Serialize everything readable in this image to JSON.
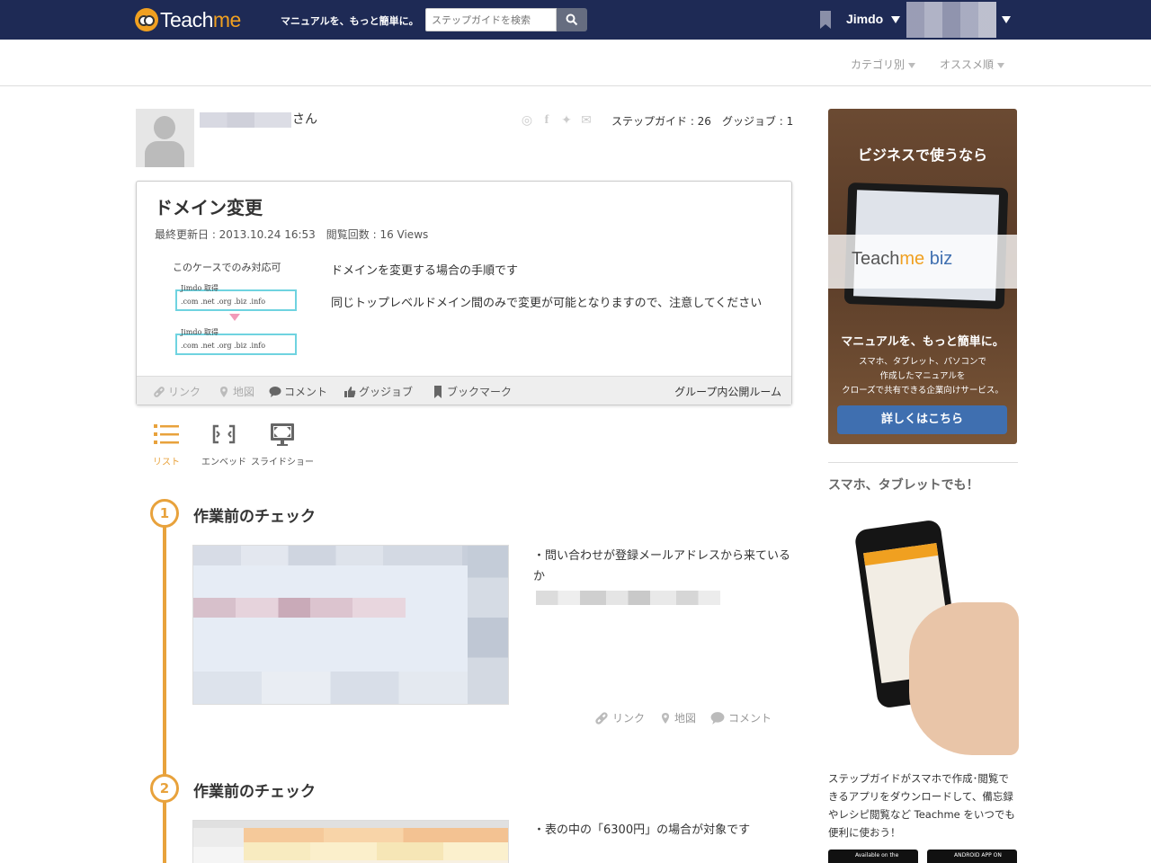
{
  "header": {
    "logo_left": "Teach",
    "logo_right": "me",
    "tagline": "マニュアルを、もっと簡単に。",
    "search_placeholder": "ステップガイドを検索",
    "user": "Jimdo"
  },
  "subbar": {
    "category": "カテゴリ別",
    "recommended": "オススメ順"
  },
  "profile": {
    "suffix": "さん",
    "stats": "ステップガイド : 26　グッジョブ : 1"
  },
  "guide": {
    "title": "ドメイン変更",
    "meta": "最終更新日 : 2013.10.24 16:53　閲覧回数 : 16 Views",
    "thumb_line1": "このケースでのみ対応可",
    "thumb_box_label": "Jimdo 取得",
    "thumb_tlds": ".com  .net  .org  .biz  .info",
    "desc1": "ドメインを変更する場合の手順です",
    "desc2": "同じトップレベルドメイン間のみで変更が可能となりますので、注意してください",
    "actions": {
      "link": "リンク",
      "map": "地図",
      "comment": "コメント",
      "goodjob": "グッジョブ",
      "bookmark": "ブックマーク"
    },
    "visibility": "グループ内公開ルーム"
  },
  "views": {
    "list": "リスト",
    "embed": "エンベッド",
    "slideshow": "スライドショー"
  },
  "steps": [
    {
      "num": "1",
      "title": "作業前のチェック",
      "text": "・問い合わせが登録メールアドレスから来ているか",
      "link": "リンク",
      "map": "地図",
      "comment": "コメント"
    },
    {
      "num": "2",
      "title": "作業前のチェック",
      "text": "・表の中の「6300円」の場合が対象です"
    }
  ],
  "sidebar": {
    "ad_title": "ビジネスで使うなら",
    "ad_logo_a": "Teach",
    "ad_logo_b": "me",
    "ad_logo_c": " biz",
    "ad_tagline": "マニュアルを、もっと簡単に。",
    "ad_desc1": "スマホ、タブレット、パソコンで",
    "ad_desc2": "作成したマニュアルを",
    "ad_desc3": "クローズで共有できる企業向けサービス。",
    "ad_button": "詳しくはこちら",
    "mobile_heading": "スマホ、タブレットでも！",
    "mobile_text": "ステップガイドがスマホで作成･閲覧できるアプリをダウンロードして、備忘録やレシピ閲覧など Teachme をいつでも便利に使おう！",
    "appstore": "Available on the",
    "android": "ANDROID APP ON"
  },
  "colors": {
    "header_bg": "#1e2a55",
    "accent": "#e8a23c",
    "button_blue": "#3f6fb0"
  }
}
